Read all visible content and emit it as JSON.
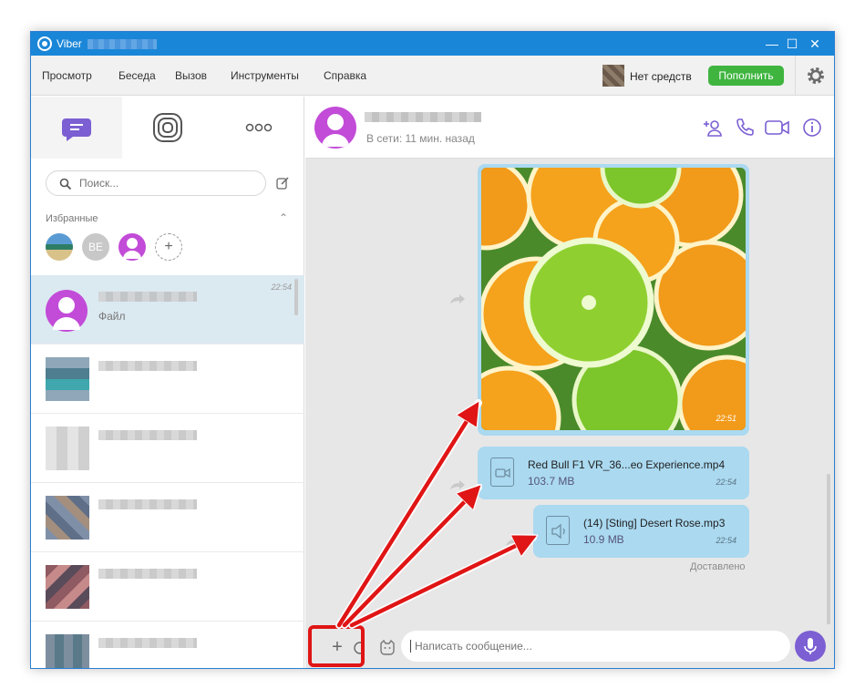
{
  "app": {
    "title": "Viber"
  },
  "window_controls": {
    "minimize": "—",
    "maximize": "☐",
    "close": "✕"
  },
  "menu": [
    "Просмотр",
    "Беседа",
    "Вызов",
    "Инструменты",
    "Справка"
  ],
  "account": {
    "balance": "Нет средств",
    "topup": "Пополнить"
  },
  "search": {
    "placeholder": "Поиск..."
  },
  "favorites": {
    "label": "Избранные",
    "items": [
      "",
      "BE",
      "",
      "+"
    ]
  },
  "chats": [
    {
      "time": "22:54",
      "message": "Файл"
    },
    {
      "time": "",
      "message": ""
    },
    {
      "time": "",
      "message": ""
    },
    {
      "time": "",
      "message": ""
    },
    {
      "time": "",
      "message": ""
    },
    {
      "time": "",
      "message": ""
    }
  ],
  "conversation": {
    "status": "В сети: 11 мин. назад",
    "image_message": {
      "time": "22:51"
    },
    "files": [
      {
        "name": "Red Bull F1 VR_36...eo Experience.mp4",
        "size": "103.7 MB",
        "time": "22:54",
        "type": "video"
      },
      {
        "name": "(14) [Sting] Desert Rose.mp3",
        "size": "10.9 MB",
        "time": "22:54",
        "type": "audio"
      }
    ],
    "delivered": "Доставлено"
  },
  "composer": {
    "placeholder": "Написать сообщение..."
  },
  "icons": {
    "tabs": [
      "chat-icon",
      "stories-icon",
      "more-icon"
    ],
    "header": [
      "add-participant-icon",
      "call-icon",
      "video-call-icon",
      "info-icon"
    ]
  },
  "colors": {
    "accent": "#7b5fd3",
    "titlebar": "#1a86d8",
    "topup": "#3fb53f",
    "bubble": "#aad9f0",
    "annotation": "#e01515"
  }
}
